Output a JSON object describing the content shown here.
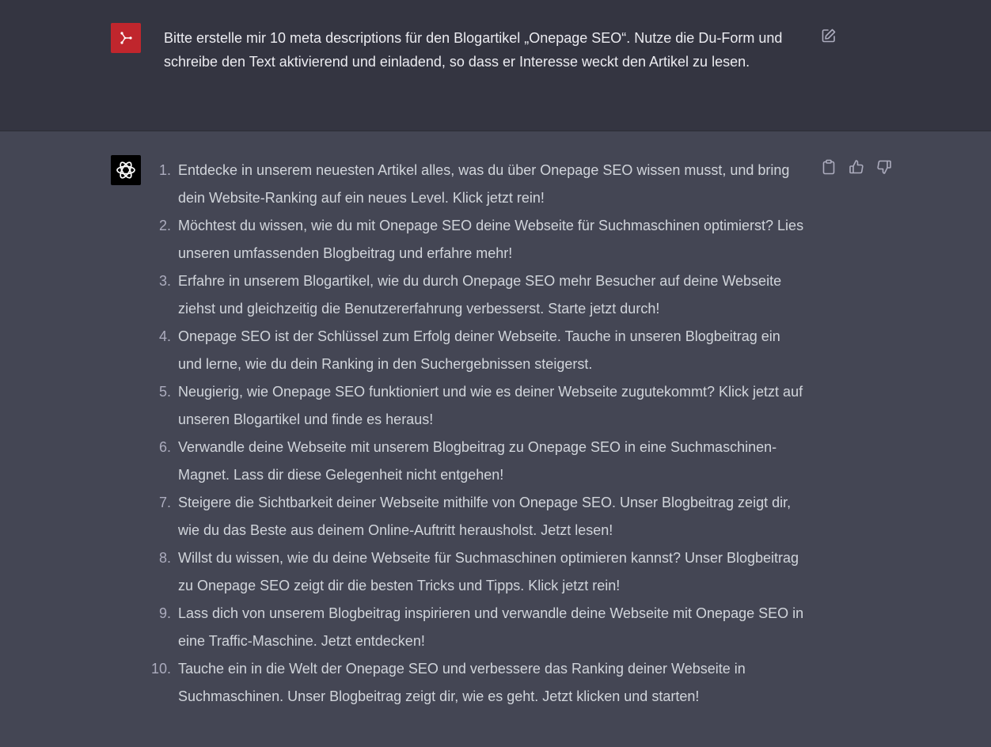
{
  "user_message": {
    "avatar_icon": "user-avatar-icon",
    "avatar_color": "#c0262d",
    "text": "Bitte erstelle mir 10 meta descriptions für den Blogartikel „Onepage SEO“. Nutze die Du-Form und schreibe den Text aktivierend und einladend, so dass er Interesse weckt den Artikel zu lesen.",
    "edit_icon": "edit-icon"
  },
  "assistant_message": {
    "avatar_icon": "openai-logo-icon",
    "items": [
      {
        "num": "1.",
        "text": "Entdecke in unserem neuesten Artikel alles, was du über Onepage SEO wissen musst, und bring dein Website-Ranking auf ein neues Level. Klick jetzt rein!"
      },
      {
        "num": "2.",
        "text": "Möchtest du wissen, wie du mit Onepage SEO deine Webseite für Suchmaschinen optimierst? Lies unseren umfassenden Blogbeitrag und erfahre mehr!"
      },
      {
        "num": "3.",
        "text": "Erfahre in unserem Blogartikel, wie du durch Onepage SEO mehr Besucher auf deine Webseite ziehst und gleichzeitig die Benutzererfahrung verbesserst. Starte jetzt durch!"
      },
      {
        "num": "4.",
        "text": "Onepage SEO ist der Schlüssel zum Erfolg deiner Webseite. Tauche in unseren Blogbeitrag ein und lerne, wie du dein Ranking in den Suchergebnissen steigerst."
      },
      {
        "num": "5.",
        "text": "Neugierig, wie Onepage SEO funktioniert und wie es deiner Webseite zugutekommt? Klick jetzt auf unseren Blogartikel und finde es heraus!"
      },
      {
        "num": "6.",
        "text": "Verwandle deine Webseite mit unserem Blogbeitrag zu Onepage SEO in eine Suchmaschinen-Magnet. Lass dir diese Gelegenheit nicht entgehen!"
      },
      {
        "num": "7.",
        "text": "Steigere die Sichtbarkeit deiner Webseite mithilfe von Onepage SEO. Unser Blogbeitrag zeigt dir, wie du das Beste aus deinem Online-Auftritt herausholst. Jetzt lesen!"
      },
      {
        "num": "8.",
        "text": "Willst du wissen, wie du deine Webseite für Suchmaschinen optimieren kannst? Unser Blogbeitrag zu Onepage SEO zeigt dir die besten Tricks und Tipps. Klick jetzt rein!"
      },
      {
        "num": "9.",
        "text": "Lass dich von unserem Blogbeitrag inspirieren und verwandle deine Webseite mit Onepage SEO in eine Traffic-Maschine. Jetzt entdecken!"
      },
      {
        "num": "10.",
        "text": "Tauche ein in die Welt der Onepage SEO und verbessere das Ranking deiner Webseite in Suchmaschinen. Unser Blogbeitrag zeigt dir, wie es geht. Jetzt klicken und starten!"
      }
    ],
    "actions": [
      "copy-icon",
      "thumbs-up-icon",
      "thumbs-down-icon"
    ]
  },
  "colors": {
    "user_bg": "#343541",
    "assistant_bg": "#444654",
    "text": "#d1d5db"
  }
}
